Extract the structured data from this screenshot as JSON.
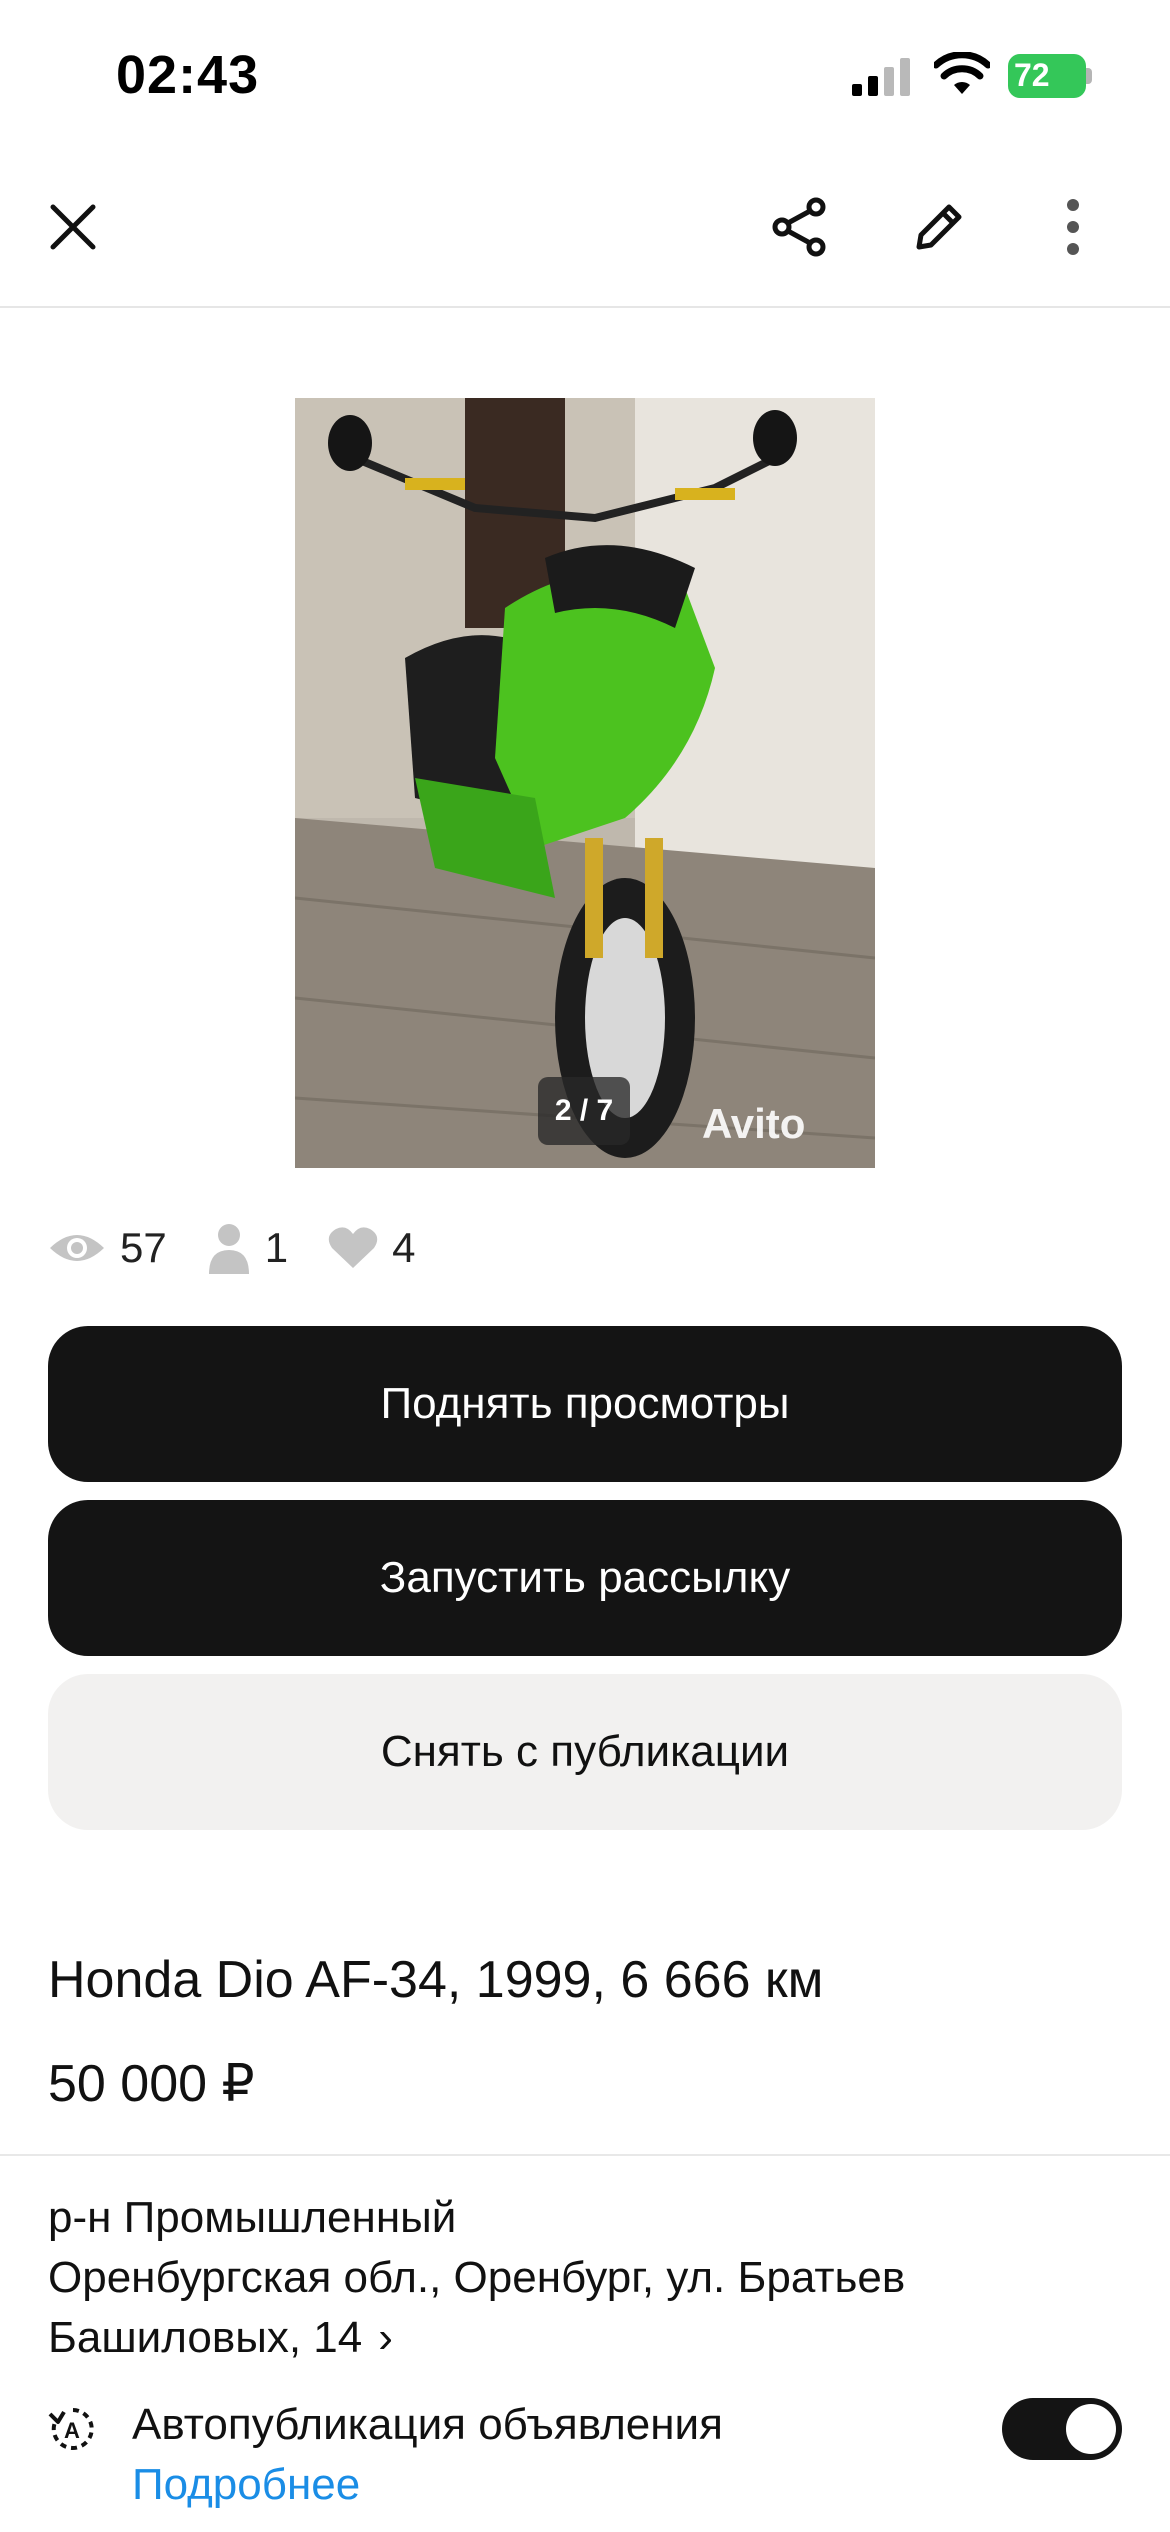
{
  "status_bar": {
    "time": "02:43",
    "battery_level": "72",
    "battery_color": "#34c759"
  },
  "toolbar": {
    "close_icon": "close-icon",
    "share_icon": "share-icon",
    "edit_icon": "pencil-icon",
    "more_icon": "more-vertical-icon"
  },
  "photo": {
    "counter": "2 / 7",
    "watermark": "Avito",
    "current_index": 2,
    "total": 7
  },
  "stats": {
    "views": "57",
    "contacts": "1",
    "favorites": "4"
  },
  "actions": {
    "raise_views": "Поднять просмотры",
    "start_mailing": "Запустить рассылку",
    "unpublish": "Снять с публикации"
  },
  "listing": {
    "title": "Honda Dio AF-34, 1999, 6 666 км",
    "price": "50 000 ₽"
  },
  "address": {
    "district": "р-н Промышленный",
    "line1": "Оренбургская обл., Оренбург, ул. Братьев",
    "line2": "Башиловых, 14"
  },
  "autopublish": {
    "label": "Автопубликация объявления",
    "more_link": "Подробнее",
    "enabled": true
  },
  "colors": {
    "primary_dark": "#141414",
    "secondary_bg": "#f2f1f0",
    "link": "#1a8de6"
  }
}
